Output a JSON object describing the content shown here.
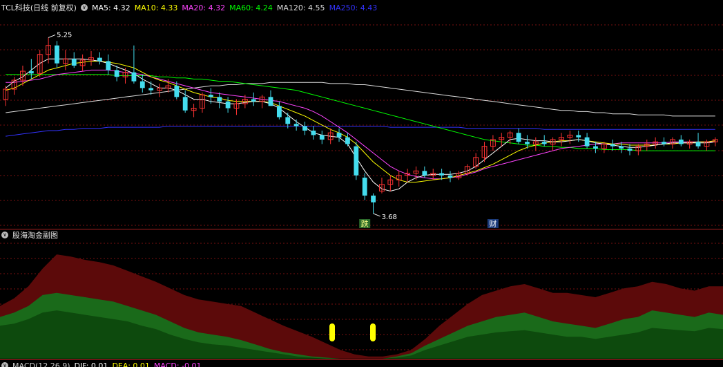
{
  "header": {
    "stock_title": "TCL科技(日线 前复权)",
    "ma_items": [
      {
        "label": "MA5: 4.32",
        "color": "#ffffff"
      },
      {
        "label": "MA10: 4.33",
        "color": "#ffff00"
      },
      {
        "label": "MA20: 4.32",
        "color": "#ff44ff"
      },
      {
        "label": "MA60: 4.24",
        "color": "#00ff00"
      },
      {
        "label": "MA120: 4.55",
        "color": "#dddddd"
      },
      {
        "label": "MA250: 4.43",
        "color": "#3333ff"
      }
    ]
  },
  "subchart": {
    "title": "股海淘金副图"
  },
  "macd": {
    "items": [
      {
        "label": "MACD(12,26,9)",
        "color": "#cccccc"
      },
      {
        "label": "DIF: 0.01",
        "color": "#ffffff"
      },
      {
        "label": "DEA: 0.01",
        "color": "#ffff00"
      },
      {
        "label": "MACD: -0.01",
        "color": "#ff44ff"
      }
    ]
  },
  "chart_data": {
    "type": "candlestick",
    "ylim": [
      3.55,
      5.45
    ],
    "high_marker": "5.25",
    "low_marker": "3.68",
    "event_labels": [
      "跌",
      "财"
    ],
    "colors": {
      "up": "#ff3333",
      "down": "#44ddee",
      "ma5": "#ffffff",
      "ma10": "#ffff00",
      "ma20": "#ff44ff",
      "ma60": "#00ff00",
      "ma120": "#dddddd",
      "ma250": "#3333ff"
    },
    "candles": [
      [
        4.7,
        4.82,
        4.64,
        4.79
      ],
      [
        4.79,
        4.9,
        4.74,
        4.87
      ],
      [
        4.87,
        5.0,
        4.82,
        4.95
      ],
      [
        4.95,
        5.06,
        4.88,
        4.93
      ],
      [
        4.93,
        5.14,
        4.9,
        5.1
      ],
      [
        5.1,
        5.25,
        5.02,
        5.18
      ],
      [
        5.18,
        5.22,
        4.98,
        5.02
      ],
      [
        5.02,
        5.14,
        4.96,
        5.06
      ],
      [
        5.06,
        5.12,
        4.98,
        5.0
      ],
      [
        5.0,
        5.1,
        4.95,
        5.05
      ],
      [
        5.05,
        5.13,
        5.0,
        5.07
      ],
      [
        5.07,
        5.12,
        5.01,
        5.04
      ],
      [
        5.04,
        5.1,
        4.92,
        4.96
      ],
      [
        4.96,
        5.0,
        4.86,
        4.9
      ],
      [
        4.9,
        4.98,
        4.84,
        4.94
      ],
      [
        4.94,
        5.18,
        4.84,
        4.86
      ],
      [
        4.86,
        4.92,
        4.76,
        4.8
      ],
      [
        4.8,
        4.86,
        4.74,
        4.78
      ],
      [
        4.78,
        4.84,
        4.72,
        4.8
      ],
      [
        4.8,
        4.88,
        4.76,
        4.82
      ],
      [
        4.82,
        4.86,
        4.7,
        4.72
      ],
      [
        4.72,
        4.78,
        4.58,
        4.6
      ],
      [
        4.6,
        4.66,
        4.54,
        4.62
      ],
      [
        4.62,
        4.76,
        4.58,
        4.74
      ],
      [
        4.74,
        4.8,
        4.66,
        4.72
      ],
      [
        4.72,
        4.76,
        4.62,
        4.68
      ],
      [
        4.68,
        4.72,
        4.58,
        4.62
      ],
      [
        4.62,
        4.7,
        4.56,
        4.66
      ],
      [
        4.66,
        4.74,
        4.62,
        4.7
      ],
      [
        4.7,
        4.76,
        4.64,
        4.68
      ],
      [
        4.68,
        4.74,
        4.62,
        4.72
      ],
      [
        4.72,
        4.78,
        4.66,
        4.64
      ],
      [
        4.64,
        4.68,
        4.52,
        4.54
      ],
      [
        4.54,
        4.58,
        4.44,
        4.48
      ],
      [
        4.48,
        4.52,
        4.42,
        4.46
      ],
      [
        4.46,
        4.5,
        4.38,
        4.42
      ],
      [
        4.42,
        4.46,
        4.34,
        4.38
      ],
      [
        4.38,
        4.42,
        4.3,
        4.34
      ],
      [
        4.34,
        4.44,
        4.3,
        4.4
      ],
      [
        4.4,
        4.44,
        4.32,
        4.36
      ],
      [
        4.36,
        4.4,
        4.28,
        4.3
      ],
      [
        4.28,
        4.32,
        3.98,
        4.02
      ],
      [
        4.0,
        4.04,
        3.8,
        3.84
      ],
      [
        3.84,
        3.86,
        3.68,
        3.78
      ],
      [
        3.88,
        4.0,
        3.86,
        3.94
      ],
      [
        3.94,
        4.02,
        3.88,
        3.98
      ],
      [
        3.98,
        4.06,
        3.92,
        4.02
      ],
      [
        4.02,
        4.08,
        3.96,
        4.04
      ],
      [
        4.04,
        4.1,
        3.98,
        4.06
      ],
      [
        4.06,
        4.1,
        4.0,
        4.02
      ],
      [
        4.02,
        4.08,
        3.98,
        4.04
      ],
      [
        4.04,
        4.08,
        3.98,
        4.02
      ],
      [
        4.02,
        4.06,
        3.96,
        4.0
      ],
      [
        4.0,
        4.06,
        3.98,
        4.04
      ],
      [
        4.04,
        4.12,
        4.02,
        4.1
      ],
      [
        4.1,
        4.22,
        4.08,
        4.18
      ],
      [
        4.18,
        4.32,
        4.14,
        4.28
      ],
      [
        4.28,
        4.38,
        4.24,
        4.34
      ],
      [
        4.34,
        4.4,
        4.28,
        4.36
      ],
      [
        4.36,
        4.42,
        4.3,
        4.4
      ],
      [
        4.4,
        4.44,
        4.3,
        4.32
      ],
      [
        4.32,
        4.38,
        4.26,
        4.3
      ],
      [
        4.3,
        4.36,
        4.24,
        4.32
      ],
      [
        4.32,
        4.38,
        4.28,
        4.3
      ],
      [
        4.3,
        4.36,
        4.24,
        4.34
      ],
      [
        4.34,
        4.4,
        4.28,
        4.36
      ],
      [
        4.36,
        4.42,
        4.3,
        4.38
      ],
      [
        4.38,
        4.42,
        4.32,
        4.36
      ],
      [
        4.36,
        4.4,
        4.26,
        4.28
      ],
      [
        4.28,
        4.32,
        4.22,
        4.26
      ],
      [
        4.26,
        4.32,
        4.22,
        4.3
      ],
      [
        4.3,
        4.34,
        4.24,
        4.28
      ],
      [
        4.28,
        4.32,
        4.22,
        4.26
      ],
      [
        4.26,
        4.3,
        4.2,
        4.24
      ],
      [
        4.24,
        4.3,
        4.2,
        4.28
      ],
      [
        4.28,
        4.34,
        4.24,
        4.3
      ],
      [
        4.3,
        4.36,
        4.26,
        4.32
      ],
      [
        4.32,
        4.36,
        4.28,
        4.3
      ],
      [
        4.3,
        4.36,
        4.26,
        4.34
      ],
      [
        4.34,
        4.38,
        4.28,
        4.3
      ],
      [
        4.3,
        4.34,
        4.26,
        4.32
      ],
      [
        4.32,
        4.4,
        4.26,
        4.28
      ],
      [
        4.28,
        4.34,
        4.24,
        4.32
      ],
      [
        4.32,
        4.36,
        4.28,
        4.34
      ]
    ],
    "ma5": [
      4.8,
      4.86,
      4.9,
      4.96,
      5.02,
      5.06,
      5.06,
      5.06,
      5.06,
      5.06,
      5.05,
      5.04,
      5.02,
      4.99,
      4.96,
      4.93,
      4.88,
      4.84,
      4.8,
      4.8,
      4.78,
      4.74,
      4.7,
      4.7,
      4.68,
      4.67,
      4.66,
      4.66,
      4.67,
      4.68,
      4.68,
      4.66,
      4.62,
      4.56,
      4.5,
      4.45,
      4.4,
      4.38,
      4.37,
      4.36,
      4.3,
      4.18,
      4.06,
      3.96,
      3.9,
      3.88,
      3.9,
      3.96,
      4.0,
      4.02,
      4.03,
      4.03,
      4.03,
      4.04,
      4.06,
      4.1,
      4.16,
      4.22,
      4.28,
      4.34,
      4.35,
      4.34,
      4.33,
      4.33,
      4.32,
      4.32,
      4.33,
      4.34,
      4.33,
      4.31,
      4.3,
      4.29,
      4.28,
      4.27,
      4.27,
      4.28,
      4.29,
      4.3,
      4.31,
      4.31,
      4.31,
      4.31,
      4.31,
      4.32
    ],
    "ma10": [
      4.78,
      4.8,
      4.84,
      4.88,
      4.92,
      4.96,
      4.98,
      5.0,
      5.02,
      5.03,
      5.04,
      5.04,
      5.03,
      5.02,
      5.0,
      4.98,
      4.94,
      4.9,
      4.87,
      4.85,
      4.82,
      4.79,
      4.76,
      4.74,
      4.72,
      4.71,
      4.69,
      4.68,
      4.68,
      4.68,
      4.68,
      4.67,
      4.64,
      4.61,
      4.58,
      4.55,
      4.51,
      4.47,
      4.43,
      4.4,
      4.36,
      4.3,
      4.22,
      4.14,
      4.08,
      4.02,
      3.98,
      3.96,
      3.96,
      3.97,
      3.98,
      3.99,
      4.0,
      4.02,
      4.04,
      4.06,
      4.09,
      4.12,
      4.16,
      4.2,
      4.24,
      4.27,
      4.29,
      4.31,
      4.32,
      4.33,
      4.33,
      4.34,
      4.33,
      4.32,
      4.31,
      4.3,
      4.3,
      4.29,
      4.29,
      4.29,
      4.29,
      4.3,
      4.3,
      4.31,
      4.31,
      4.32,
      4.32,
      4.33
    ],
    "ma20": [
      4.85,
      4.85,
      4.86,
      4.87,
      4.88,
      4.9,
      4.92,
      4.93,
      4.94,
      4.95,
      4.96,
      4.96,
      4.96,
      4.95,
      4.94,
      4.93,
      4.92,
      4.9,
      4.88,
      4.86,
      4.84,
      4.82,
      4.8,
      4.78,
      4.76,
      4.75,
      4.74,
      4.73,
      4.72,
      4.71,
      4.7,
      4.69,
      4.68,
      4.66,
      4.64,
      4.62,
      4.59,
      4.55,
      4.5,
      4.45,
      4.4,
      4.34,
      4.28,
      4.22,
      4.16,
      4.1,
      4.06,
      4.03,
      4.01,
      4.0,
      3.99,
      3.99,
      4.0,
      4.01,
      4.03,
      4.05,
      4.08,
      4.1,
      4.12,
      4.14,
      4.16,
      4.18,
      4.2,
      4.22,
      4.24,
      4.26,
      4.27,
      4.28,
      4.29,
      4.3,
      4.3,
      4.3,
      4.31,
      4.31,
      4.31,
      4.31,
      4.31,
      4.31,
      4.32,
      4.32,
      4.32,
      4.32,
      4.32,
      4.32
    ],
    "ma60": [
      4.92,
      4.92,
      4.92,
      4.92,
      4.92,
      4.92,
      4.92,
      4.92,
      4.92,
      4.92,
      4.92,
      4.92,
      4.92,
      4.91,
      4.91,
      4.91,
      4.91,
      4.91,
      4.9,
      4.9,
      4.89,
      4.89,
      4.88,
      4.88,
      4.87,
      4.86,
      4.86,
      4.85,
      4.84,
      4.83,
      4.82,
      4.81,
      4.8,
      4.79,
      4.78,
      4.76,
      4.74,
      4.72,
      4.7,
      4.68,
      4.66,
      4.64,
      4.62,
      4.6,
      4.58,
      4.56,
      4.54,
      4.52,
      4.5,
      4.48,
      4.46,
      4.44,
      4.42,
      4.4,
      4.38,
      4.36,
      4.34,
      4.33,
      4.32,
      4.31,
      4.3,
      4.29,
      4.29,
      4.28,
      4.28,
      4.27,
      4.27,
      4.26,
      4.26,
      4.26,
      4.25,
      4.25,
      4.25,
      4.25,
      4.24,
      4.24,
      4.24,
      4.24,
      4.24,
      4.24,
      4.24,
      4.24,
      4.24,
      4.24
    ],
    "ma120": [
      4.58,
      4.59,
      4.6,
      4.61,
      4.62,
      4.63,
      4.64,
      4.65,
      4.66,
      4.67,
      4.68,
      4.69,
      4.7,
      4.71,
      4.72,
      4.73,
      4.74,
      4.75,
      4.76,
      4.77,
      4.78,
      4.79,
      4.8,
      4.81,
      4.82,
      4.82,
      4.83,
      4.83,
      4.84,
      4.84,
      4.84,
      4.85,
      4.85,
      4.85,
      4.85,
      4.85,
      4.85,
      4.85,
      4.84,
      4.84,
      4.84,
      4.83,
      4.83,
      4.82,
      4.81,
      4.8,
      4.79,
      4.78,
      4.77,
      4.76,
      4.75,
      4.74,
      4.73,
      4.72,
      4.71,
      4.7,
      4.69,
      4.68,
      4.67,
      4.66,
      4.65,
      4.64,
      4.63,
      4.62,
      4.61,
      4.6,
      4.6,
      4.59,
      4.59,
      4.58,
      4.58,
      4.57,
      4.57,
      4.57,
      4.56,
      4.56,
      4.56,
      4.56,
      4.55,
      4.55,
      4.55,
      4.55,
      4.55,
      4.55
    ],
    "ma250": [
      4.37,
      4.38,
      4.39,
      4.4,
      4.41,
      4.42,
      4.42,
      4.43,
      4.43,
      4.44,
      4.44,
      4.44,
      4.45,
      4.45,
      4.45,
      4.45,
      4.45,
      4.45,
      4.45,
      4.46,
      4.46,
      4.46,
      4.46,
      4.46,
      4.46,
      4.46,
      4.46,
      4.46,
      4.46,
      4.46,
      4.46,
      4.46,
      4.46,
      4.46,
      4.46,
      4.46,
      4.46,
      4.46,
      4.46,
      4.46,
      4.46,
      4.46,
      4.46,
      4.46,
      4.46,
      4.45,
      4.45,
      4.45,
      4.45,
      4.45,
      4.45,
      4.45,
      4.45,
      4.45,
      4.44,
      4.44,
      4.44,
      4.44,
      4.44,
      4.44,
      4.44,
      4.44,
      4.44,
      4.43,
      4.43,
      4.43,
      4.43,
      4.43,
      4.43,
      4.43,
      4.43,
      4.43,
      4.43,
      4.43,
      4.43,
      4.43,
      4.43,
      4.43,
      4.43,
      4.43,
      4.43,
      4.43,
      4.43,
      4.43
    ],
    "sub_dark_red": [
      0.48,
      0.55,
      0.66,
      0.82,
      0.95,
      0.93,
      0.9,
      0.88,
      0.85,
      0.8,
      0.75,
      0.7,
      0.64,
      0.58,
      0.54,
      0.52,
      0.5,
      0.48,
      0.42,
      0.36,
      0.3,
      0.25,
      0.2,
      0.14,
      0.08,
      0.04,
      0.02,
      0.02,
      0.04,
      0.08,
      0.18,
      0.3,
      0.4,
      0.5,
      0.58,
      0.62,
      0.66,
      0.68,
      0.64,
      0.6,
      0.6,
      0.58,
      0.56,
      0.6,
      0.64,
      0.66,
      0.7,
      0.68,
      0.64,
      0.62,
      0.66,
      0.66
    ],
    "sub_green": [
      0.38,
      0.42,
      0.48,
      0.58,
      0.6,
      0.58,
      0.56,
      0.54,
      0.52,
      0.48,
      0.44,
      0.4,
      0.34,
      0.28,
      0.24,
      0.22,
      0.2,
      0.17,
      0.13,
      0.09,
      0.06,
      0.04,
      0.02,
      0.01,
      0.0,
      0.0,
      0.0,
      0.0,
      0.02,
      0.05,
      0.12,
      0.18,
      0.24,
      0.3,
      0.34,
      0.38,
      0.4,
      0.42,
      0.38,
      0.34,
      0.32,
      0.3,
      0.28,
      0.32,
      0.36,
      0.38,
      0.44,
      0.42,
      0.4,
      0.38,
      0.42,
      0.4
    ],
    "sub_inner": [
      0.3,
      0.32,
      0.36,
      0.42,
      0.44,
      0.42,
      0.4,
      0.38,
      0.36,
      0.34,
      0.3,
      0.27,
      0.22,
      0.18,
      0.15,
      0.13,
      0.12,
      0.1,
      0.08,
      0.06,
      0.04,
      0.02,
      0.01,
      0.0,
      0.0,
      0.0,
      0.0,
      0.0,
      0.01,
      0.03,
      0.08,
      0.12,
      0.16,
      0.2,
      0.22,
      0.24,
      0.25,
      0.26,
      0.24,
      0.22,
      0.2,
      0.2,
      0.18,
      0.2,
      0.22,
      0.24,
      0.28,
      0.27,
      0.26,
      0.25,
      0.28,
      0.27
    ]
  }
}
